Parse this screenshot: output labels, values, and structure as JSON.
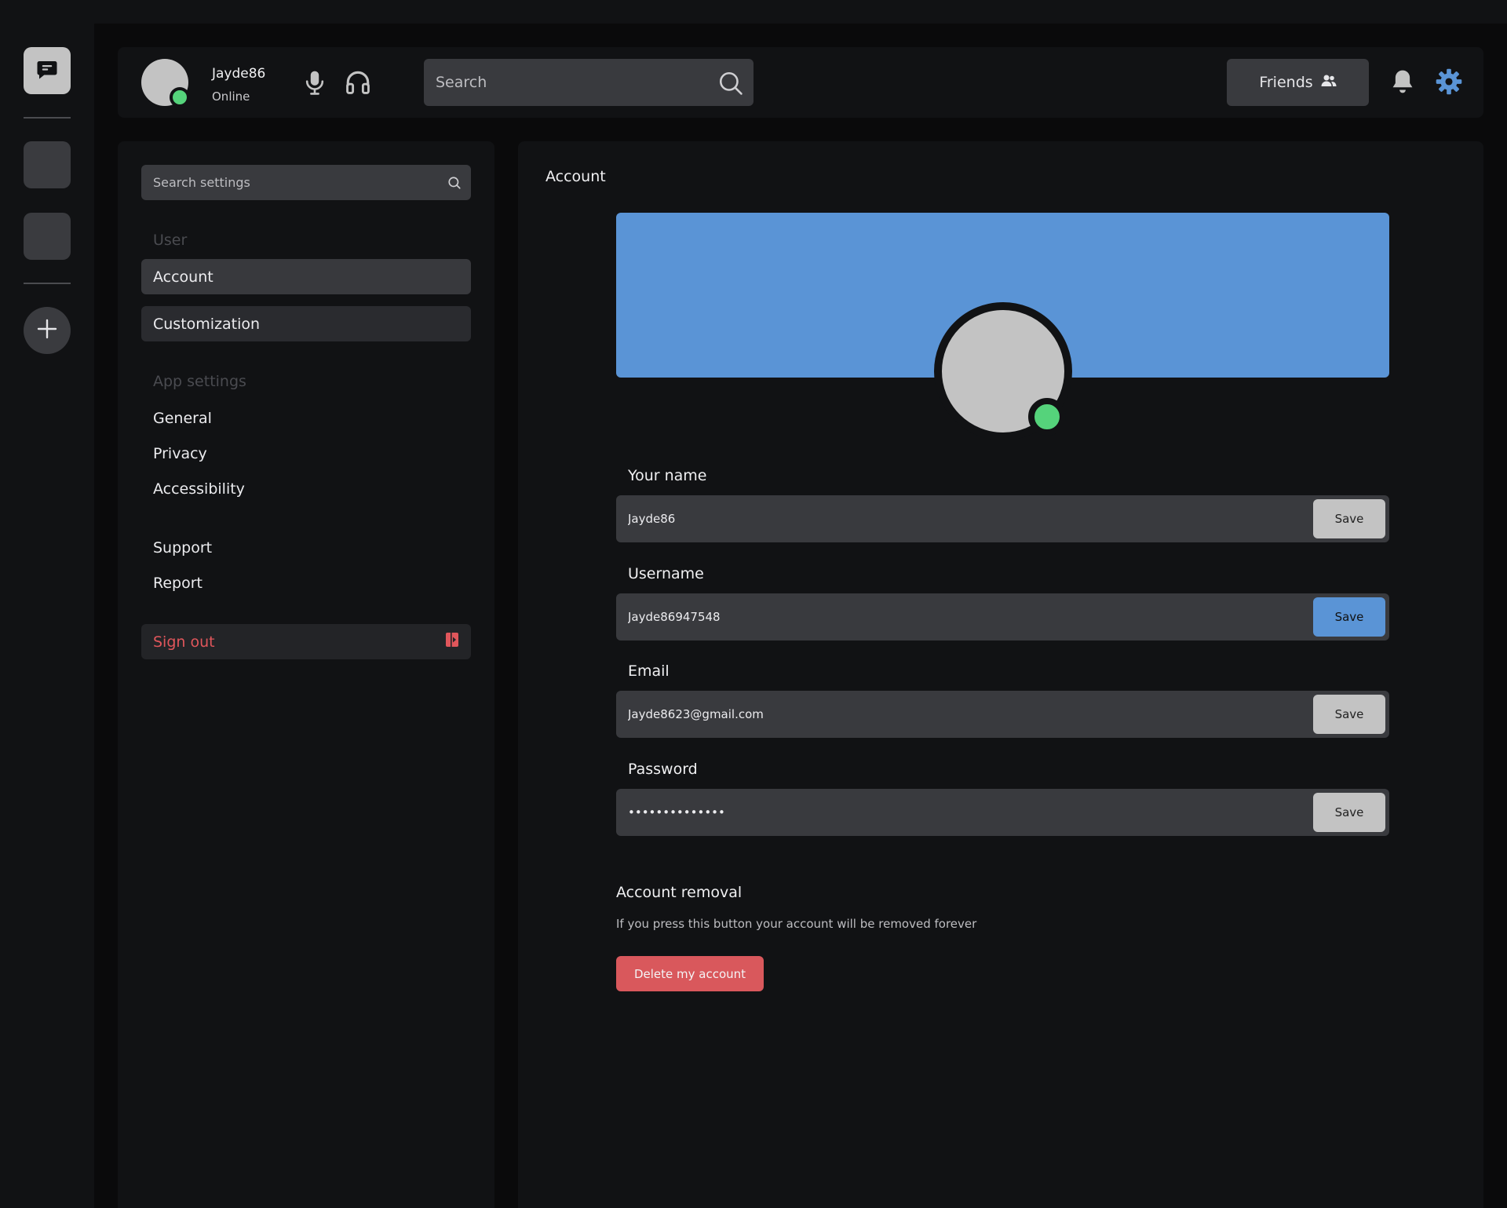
{
  "colors": {
    "accent": "#5a94d6",
    "online": "#55d37b",
    "danger": "#d9585c",
    "background": "#0a0a0b",
    "panel": "#111214",
    "field": "#393a3e"
  },
  "rail": {
    "icons": [
      "chat-icon",
      "plus-icon"
    ]
  },
  "header": {
    "user": {
      "name": "Jayde86",
      "status": "Online"
    },
    "icons": [
      "microphone-icon",
      "headphones-icon",
      "search-icon",
      "bell-icon",
      "gear-icon"
    ],
    "search_placeholder": "Search",
    "friends_label": "Friends"
  },
  "sidebar": {
    "search_placeholder": "Search settings",
    "user_section": "User",
    "user_items": [
      "Account",
      "Customization"
    ],
    "app_section": "App settings",
    "app_items": [
      "General",
      "Privacy",
      "Accessibility"
    ],
    "other_items": [
      "Support",
      "Report"
    ],
    "sign_out": "Sign out",
    "selected": "Account"
  },
  "main": {
    "title": "Account",
    "fields": [
      {
        "label": "Your name",
        "value": "Jayde86",
        "button": "Save"
      },
      {
        "label": "Username",
        "value": "Jayde86947548",
        "button": "Save"
      },
      {
        "label": "Email",
        "value": "Jayde8623@gmail.com",
        "button": "Save"
      },
      {
        "label": "Password",
        "value": "••••••••••••••",
        "button": "Save"
      }
    ],
    "removal": {
      "title": "Account removal",
      "description": "If you press this button your account will be removed forever",
      "button": "Delete my account"
    }
  }
}
